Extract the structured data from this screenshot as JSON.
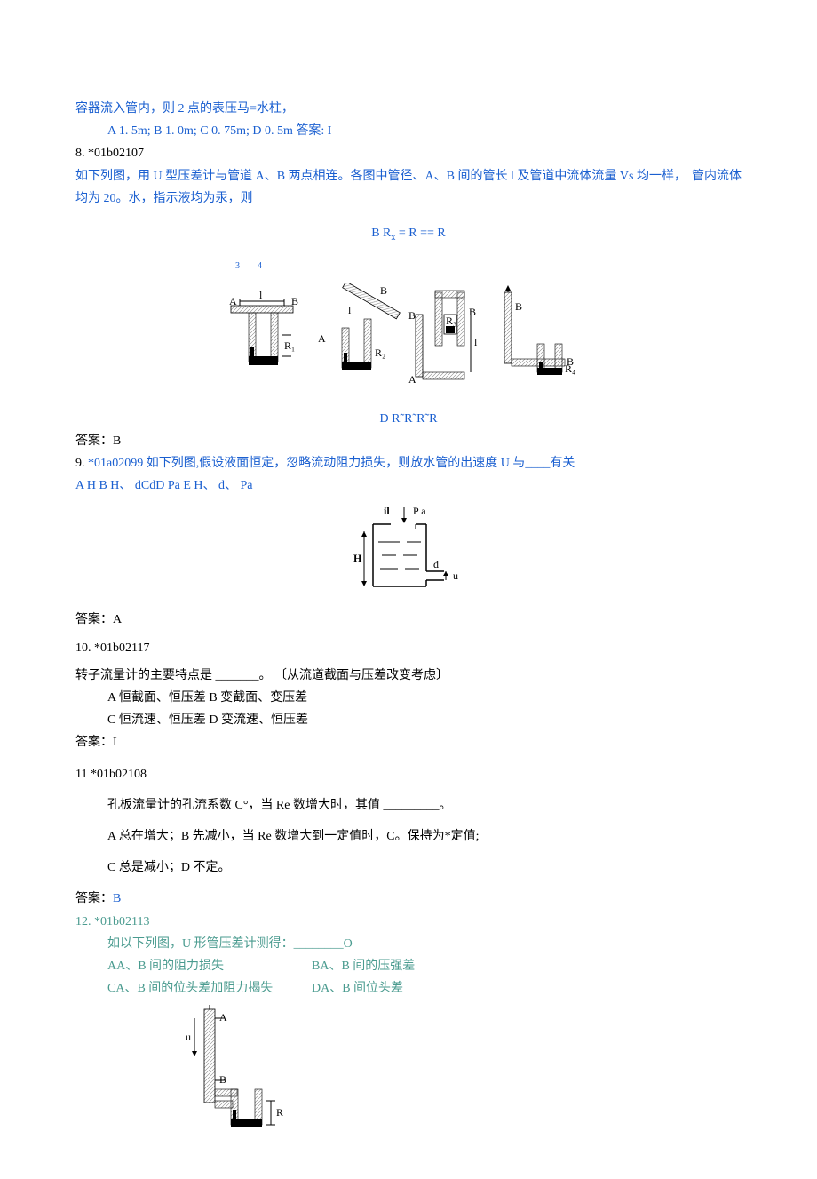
{
  "q7_tail": {
    "line1": "容器流入管内，则 2 点的表压马=水柱，",
    "options": "A 1. 5m; B 1. 0m; C 0. 75m; D 0. 5m 答案: I"
  },
  "q8": {
    "num_code": "8. *01b02107",
    "body1": "如下列图，用 U 型压差计与管道 A、B 两点相连。各图中管径、A、B 间的管长 l 及管道中流体流量 Vs 均一样，",
    "body1_right": "管内流体",
    "body2": "均为 20。水，指示液均为汞，则",
    "formula_b": "B R",
    "formula_sub_x": "x",
    "formula_rest": " = R == R",
    "sub34": "3        4",
    "caption_d": "D R˜R˜R˜R",
    "answer": "答案：B"
  },
  "q9": {
    "line1_a": "9. ",
    "line1_b": "*01a02099 如下列图,假设液面恒定，忽略流动阻力损失，则放水管的出速度 U 与____有关",
    "line2": "A H B H、 dCdD Pa E H、 d、 Pa",
    "answer": "答案：A"
  },
  "q10": {
    "head": "10.  *01b02117",
    "body": "转子流量计的主要特点是 _______。 〔从流道截面与压差改变考虑〕",
    "optA": "A 恒截面、恒压差 B 变截面、变压差",
    "optB": "C 恒流速、恒压差 D 变流速、恒压差",
    "answer": "答案：I"
  },
  "q11": {
    "head": "11 *01b02108",
    "body": "孔板流量计的孔流系数 C°，当 Re 数增大时，其值 _________。",
    "optA": "A 总在增大；B 先减小，当 Re 数增大到一定值时，C。保持为*定值;",
    "optB": "C 总是减小；D 不定。",
    "answer_label": "答案：",
    "answer_val": "B"
  },
  "q12": {
    "head": "12. *01b02113",
    "body": "如以下列图，U 形管压差计测得：________O",
    "optA": "AA、B 间的阻力损失",
    "optB": "BA、B 间的压强差",
    "optC": "CA、B 间的位头差加阻力揭失",
    "optD": "DA、B 间位头差"
  },
  "fig8": {
    "A": "A",
    "B": "B",
    "l": "l",
    "R1": "R₁",
    "R2": "R₂",
    "R3": "R₃",
    "R4": "R₄"
  },
  "fig9": {
    "il": "il",
    "Pa": "P a",
    "H": "H",
    "d": "d",
    "u": "u"
  },
  "fig12": {
    "A": "A",
    "B": "B",
    "u": "u",
    "R": "R"
  }
}
